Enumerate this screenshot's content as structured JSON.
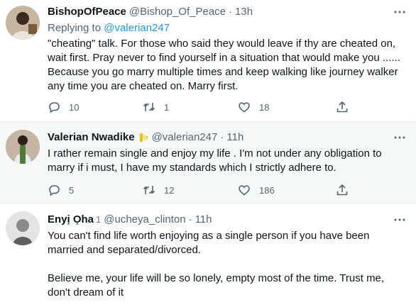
{
  "tweets": [
    {
      "name": "BishopOfPeace",
      "handle": "@Bishop_Of_Peace",
      "separator": "·",
      "time": "13h",
      "replying_prefix": "Replying to",
      "replying_to": "@valerian247",
      "text": "\"cheating\" talk. For those who said they would leave if thy are cheated on,\nwait first. Pray never to find yourself in a situation that would make you ......\nBecause you go marry multiple times and keep walking like journey walker\nany time you are cheated on. Marry first.",
      "replies": "10",
      "retweets": "1",
      "likes": "18"
    },
    {
      "name": "Valerian Nwadike",
      "handle": "@valerian247",
      "separator": "·",
      "time": "11h",
      "text": "I rather remain single and enjoy my life . I'm not under any obligation to\nmarry if i must, I have my standards which I strictly adhere to.",
      "replies": "5",
      "retweets": "12",
      "likes": "186"
    },
    {
      "name": "Enyị Ọha",
      "name_suffix": "1",
      "handle": "@ucheya_clinton",
      "separator": "·",
      "time": "11h",
      "text": "You can't find life worth enjoying as a single person if you have been\nmarried and separated/divorced.\n\nBelieve me, your life will be so lonely, empty most of the time. Trust me,\ndon't dream of it"
    }
  ],
  "icons": {
    "more": "more-horizontal-icon",
    "reply": "reply-bubble-icon",
    "retweet": "retweet-icon",
    "like": "heart-icon",
    "share": "share-upload-icon",
    "badge": "yellow-flag-icon"
  },
  "colors": {
    "link": "#1d9bf0",
    "muted": "#536471",
    "text": "#0f1419",
    "highlight_bg": "#f7f9f9"
  }
}
